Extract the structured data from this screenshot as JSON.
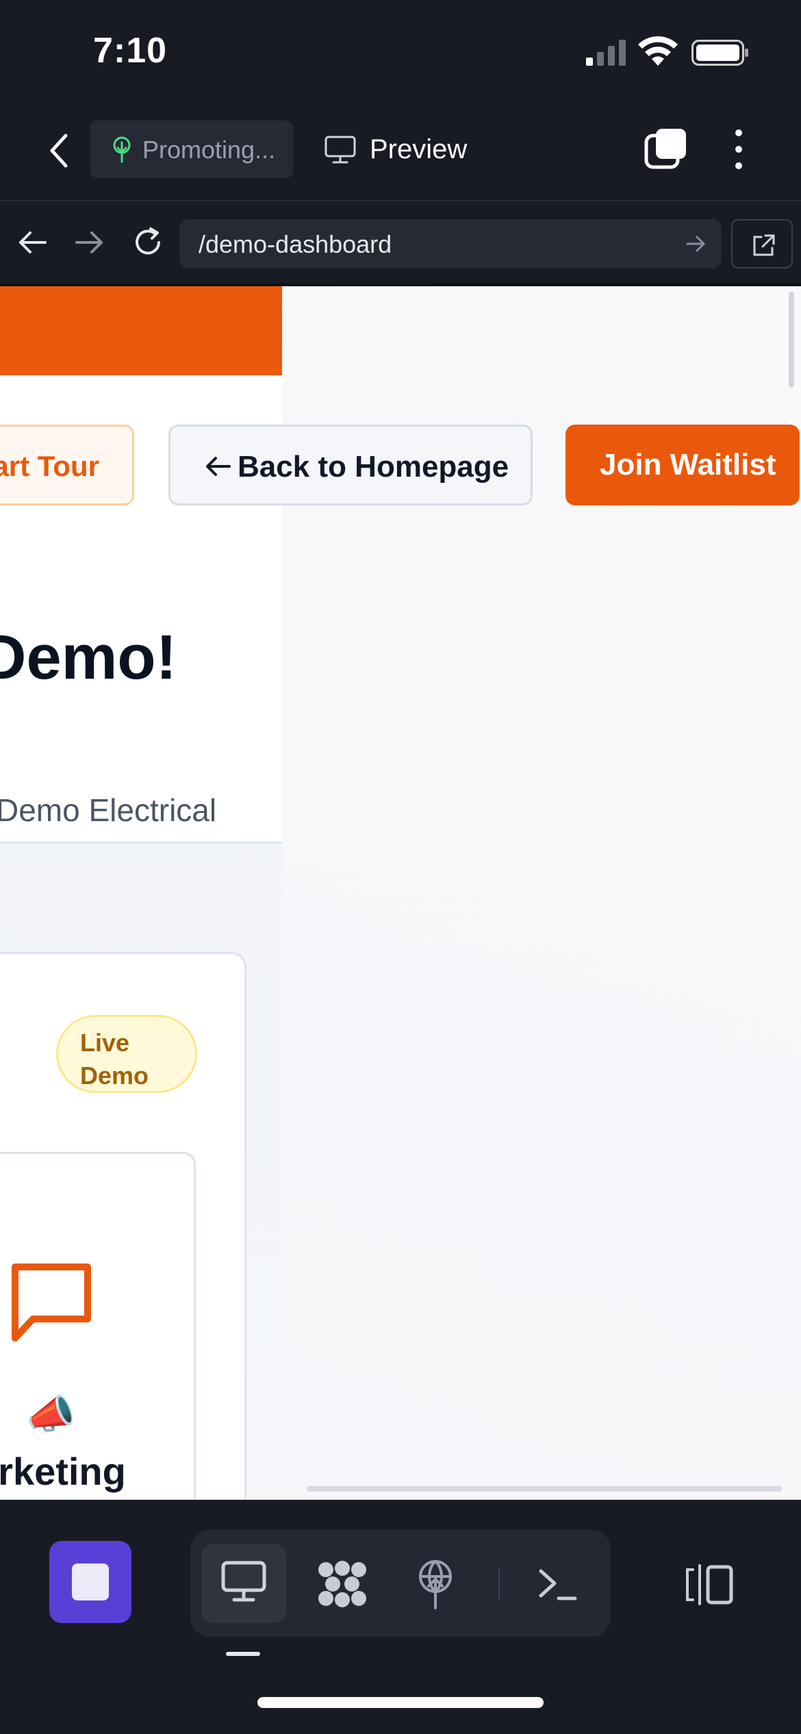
{
  "status_bar": {
    "time": "7:10",
    "icons": [
      "cellular-signal-icon",
      "wifi-icon",
      "battery-icon"
    ]
  },
  "app_bar": {
    "project_label": "Promoting...",
    "preview_label": "Preview",
    "icons": [
      "back-chevron-icon",
      "tree-icon",
      "monitor-icon",
      "windows-icon",
      "kebab-menu-icon"
    ]
  },
  "url_bar": {
    "url": "/demo-dashboard",
    "icons": [
      "arrow-left-icon",
      "arrow-right-icon",
      "reload-icon",
      "go-arrow-icon",
      "external-link-icon"
    ]
  },
  "page": {
    "tour_button": "art Tour",
    "home_button": "Back to Homepage",
    "join_button": "Join Waitlist",
    "headline": "Demo!",
    "subtext": "Demo Electrical",
    "badge": "Live Demo",
    "card_title": "arketing",
    "megaphone": "📣"
  },
  "toolbar": {
    "icons": [
      "stop-icon",
      "monitor-icon",
      "dots-grid-icon",
      "deploy-icon",
      "terminal-icon",
      "panel-toggle-icon"
    ]
  },
  "colors": {
    "accent_orange": "#ea580c",
    "stop_purple": "#5a3fd6",
    "chrome_dark": "#181b24"
  }
}
